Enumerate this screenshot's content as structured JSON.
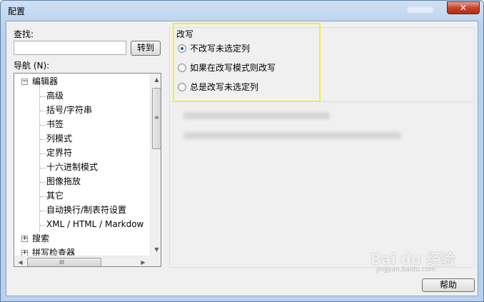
{
  "window": {
    "title": "配置",
    "close_glyph": "✕"
  },
  "search": {
    "label": "查找:",
    "value": "",
    "goto_label": "转到"
  },
  "nav": {
    "label": "导航 (N):",
    "items": [
      {
        "label": "编辑器",
        "level": 0,
        "expander": "−"
      },
      {
        "label": "高级",
        "level": 1
      },
      {
        "label": "括号/字符串",
        "level": 1
      },
      {
        "label": "书签",
        "level": 1
      },
      {
        "label": "列模式",
        "level": 1
      },
      {
        "label": "定界符",
        "level": 1
      },
      {
        "label": "十六进制模式",
        "level": 1
      },
      {
        "label": "图像拖放",
        "level": 1
      },
      {
        "label": "其它",
        "level": 1
      },
      {
        "label": "自动换行/制表符设置",
        "level": 1
      },
      {
        "label": "XML / HTML / Markdow",
        "level": 1
      },
      {
        "label": "搜索",
        "level": 0,
        "expander": "+"
      },
      {
        "label": "拼写检查器",
        "level": 0,
        "expander": "+"
      }
    ],
    "scroll_up": "▲",
    "scroll_down": "▼",
    "scroll_left": "◀",
    "scroll_right": "▶",
    "grip_v": "≡",
    "grip_h": "III"
  },
  "overwrite": {
    "legend": "改写",
    "options": [
      {
        "label": "不改写未选定列",
        "selected": true
      },
      {
        "label": "如果在改写模式则改写",
        "selected": false
      },
      {
        "label": "总是改写未选定列",
        "selected": false
      }
    ]
  },
  "footer": {
    "help_label": "帮助"
  },
  "watermark": {
    "text": "Bai du 经验",
    "sub": "jingyan.baidu.com"
  }
}
